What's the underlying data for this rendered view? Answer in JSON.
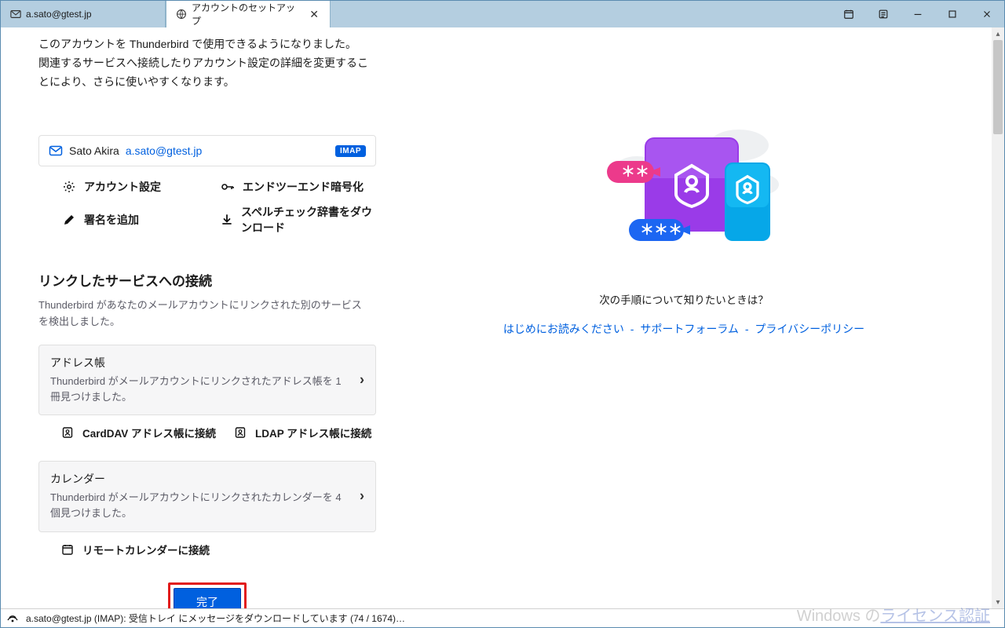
{
  "tabs": {
    "inactive_label": "a.sato@gtest.jp",
    "active_label": "アカウントのセットアップ"
  },
  "intro": {
    "line1": "このアカウントを Thunderbird で使用できるようになりました。",
    "line2": "関連するサービスへ接続したりアカウント設定の詳細を変更することにより、さらに使いやすくなります。"
  },
  "account": {
    "display_name": "Sato Akira",
    "email": "a.sato@gtest.jp",
    "protocol_badge": "IMAP"
  },
  "actions": {
    "account_settings": "アカウント設定",
    "e2e": "エンドツーエンド暗号化",
    "add_signature": "署名を追加",
    "download_dict": "スペルチェック辞書をダウンロード"
  },
  "linked": {
    "title": "リンクしたサービスへの接続",
    "desc": "Thunderbird があなたのメールアカウントにリンクされた別のサービスを検出しました。"
  },
  "addressbook": {
    "title": "アドレス帳",
    "desc": "Thunderbird がメールアカウントにリンクされたアドレス帳を 1 冊見つけました。",
    "carddav": "CardDAV アドレス帳に接続",
    "ldap": "LDAP アドレス帳に接続"
  },
  "calendar": {
    "title": "カレンダー",
    "desc": "Thunderbird がメールアカウントにリンクされたカレンダーを 4 個見つけました。",
    "remote": "リモートカレンダーに接続"
  },
  "done_label": "完了",
  "right": {
    "question": "次の手順について知りたいときは？",
    "link1": "はじめにお読みください",
    "link2": "サポートフォーラム",
    "link3": "プライバシーポリシー"
  },
  "statusbar": {
    "text": "a.sato@gtest.jp (IMAP): 受信トレイ にメッセージをダウンロードしています (74 / 1674)…"
  },
  "watermark": {
    "prefix": "Windows の",
    "link": "ライセンス認証"
  }
}
